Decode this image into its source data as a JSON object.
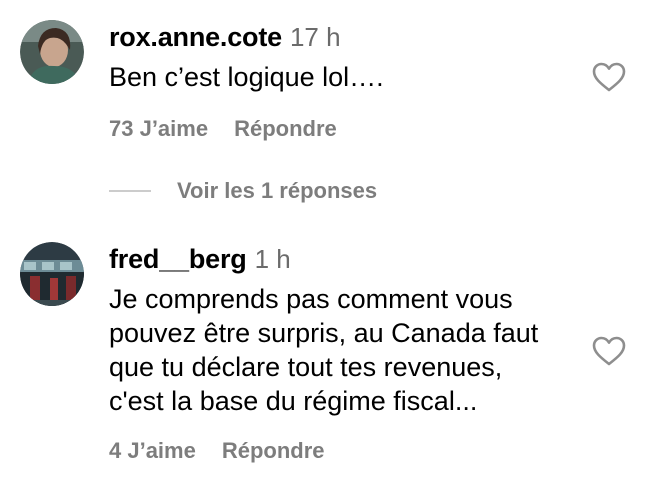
{
  "comments": [
    {
      "username": "rox.anne.cote",
      "time": "17 h",
      "text": "Ben c’est logique lol….",
      "likes": "73 J’aime",
      "reply": "Répondre",
      "view_replies": "Voir les 1 réponses"
    },
    {
      "username": "fred__berg",
      "time": "1 h",
      "text": "Je comprends pas comment vous\npouvez être surpris, au Canada faut\nque tu déclare tout tes revenues,\nc'est la base du régime fiscal...",
      "likes": "4 J’aime",
      "reply": "Répondre"
    }
  ],
  "colors": {
    "meta_gray": "#7d7d7d",
    "time_gray": "#6b6b6b",
    "heart_outline": "#8e8e8e"
  },
  "icons": {
    "like": "heart-outline-icon"
  }
}
